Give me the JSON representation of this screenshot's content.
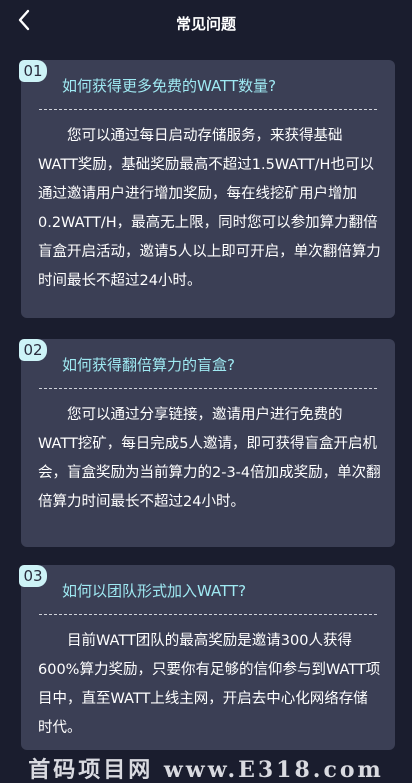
{
  "header": {
    "title": "常见问题",
    "back_icon": "chevron-left-icon"
  },
  "faq": [
    {
      "number": "01",
      "question": "如何获得更多免费的WATT数量?",
      "answer": "您可以通过每日启动存储服务，来获得基础WATT奖励，基础奖励最高不超过1.5WATT/H也可以通过邀请用户进行增加奖励，每在线挖矿用户增加0.2WATT/H，最高无上限，同时您可以参加算力翻倍盲盒开启活动，邀请5人以上即可开启，单次翻倍算力时间最长不超过24小时。"
    },
    {
      "number": "02",
      "question": "如何获得翻倍算力的盲盒?",
      "answer": "您可以通过分享链接，邀请用户进行免费的WATT挖矿，每日完成5人邀请，即可获得盲盒开启机会，盲盒奖励为当前算力的2-3-4倍加成奖励，单次翻倍算力时间最长不超过24小时。"
    },
    {
      "number": "03",
      "question": "如何以团队形式加入WATT?",
      "answer": "目前WATT团队的最高奖励是邀请300人获得600%算力奖励，只要你有足够的信仰参与到WATT项目中，直至WATT上线主网，开启去中心化网络存储时代。"
    }
  ],
  "watermark": "首码项目网 www.E318.com",
  "colors": {
    "background": "#1a1d2e",
    "card": "#3b3f55",
    "question": "#9fe9f2",
    "badge": "#cdf3f7"
  }
}
